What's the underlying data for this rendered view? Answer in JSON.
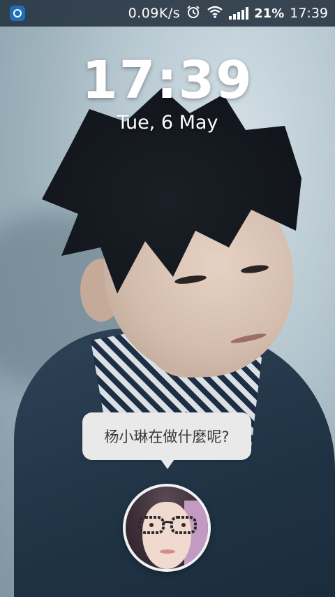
{
  "status_bar": {
    "network_speed": "0.09K/s",
    "battery_percent": "21%",
    "time": "17:39",
    "icons": [
      "app-notification-icon",
      "alarm-icon",
      "wifi-icon",
      "signal-icon"
    ]
  },
  "lock_screen": {
    "clock": "17:39",
    "date": "Tue, 6 May"
  },
  "chat_head": {
    "message": "杨小琳在做什麼呢?"
  },
  "colors": {
    "status_bar_bg": "#1e2d3a",
    "bubble_bg": "#e9e9e9",
    "text_white": "#ffffff"
  }
}
